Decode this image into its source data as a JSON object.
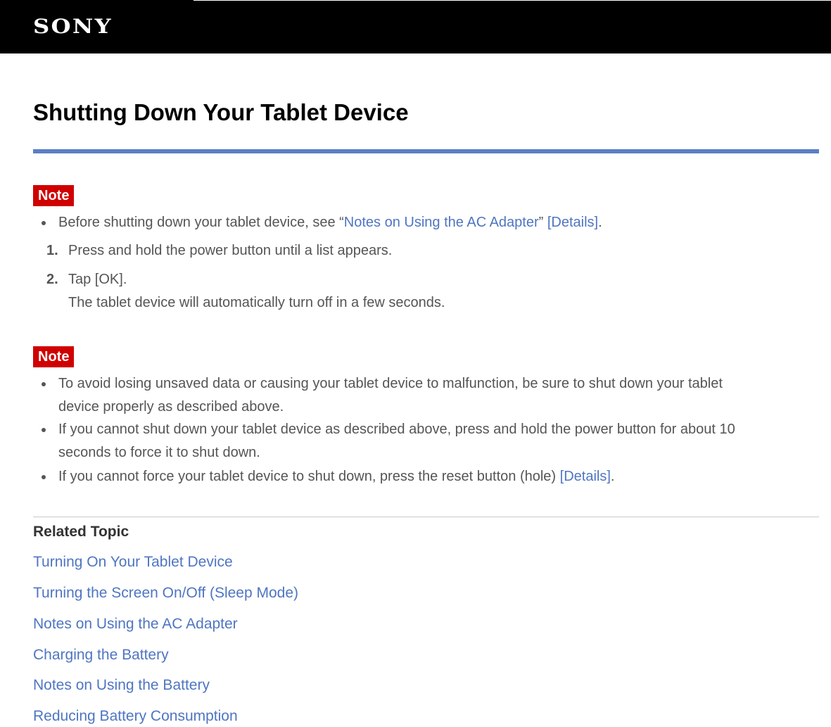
{
  "header": {
    "brand": "SONY"
  },
  "page": {
    "title": "Shutting Down Your Tablet Device"
  },
  "note1": {
    "badge": "Note",
    "bullets": [
      {
        "before": "Before shutting down your tablet device, see “",
        "link": "Notes on Using the AC Adapter",
        "after_quote": "” ",
        "details": "[Details]",
        "end": "."
      }
    ]
  },
  "steps": [
    {
      "number": "1.",
      "text": "Press and hold the power button until a list appears."
    },
    {
      "number": "2.",
      "text": "Tap [OK].",
      "subtext": "The tablet device will automatically turn off in a few seconds."
    }
  ],
  "note2": {
    "badge": "Note",
    "bullets": [
      {
        "line1": "To avoid losing unsaved data or causing your tablet device to malfunction, be sure to shut down your tablet",
        "line2": "device properly as described above."
      },
      {
        "line1": "If you cannot shut down your tablet device as described above, press and hold the power button for about 10",
        "line2": "seconds to force it to shut down."
      },
      {
        "text": "If you cannot force your tablet device to shut down, press the reset button (hole) ",
        "details": "[Details]",
        "end": "."
      }
    ]
  },
  "related": {
    "title": "Related Topic",
    "links": [
      "Turning On Your Tablet Device",
      "Turning the Screen On/Off (Sleep Mode)",
      "Notes on Using the AC Adapter",
      "Charging the Battery",
      "Notes on Using the Battery",
      "Reducing Battery Consumption"
    ]
  },
  "colors": {
    "header_bg": "#000000",
    "accent_rule": "#5a7fc4",
    "note_badge": "#d00000",
    "link": "#4f75c2",
    "body_text": "#555555"
  }
}
